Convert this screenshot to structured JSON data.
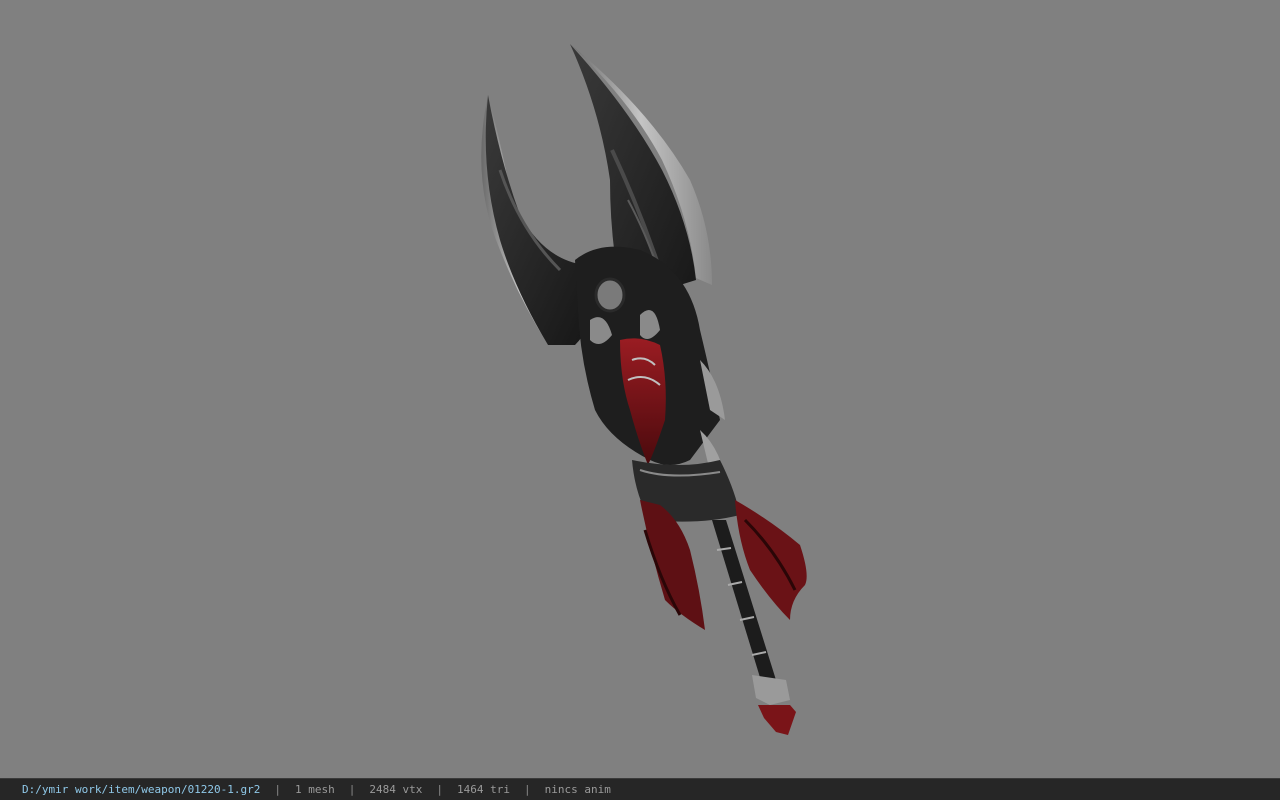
{
  "viewer": {
    "background_color": "#808080",
    "model_icon": "weapon-scythe-model"
  },
  "status_bar": {
    "file_path": "D:/ymir work/item/weapon/01220-1.gr2",
    "separator": "|",
    "mesh_count": "1 mesh",
    "vertex_count": "2484 vtx",
    "triangle_count": "1464 tri",
    "animation": "nincs anim"
  },
  "colors": {
    "status_bar_bg": "#262626",
    "path_text": "#8fc8e8",
    "info_text": "#9a9a9a",
    "blade_dark": "#2a2a2a",
    "blade_edge": "#b0b0b0",
    "accent_red": "#7a1418"
  }
}
